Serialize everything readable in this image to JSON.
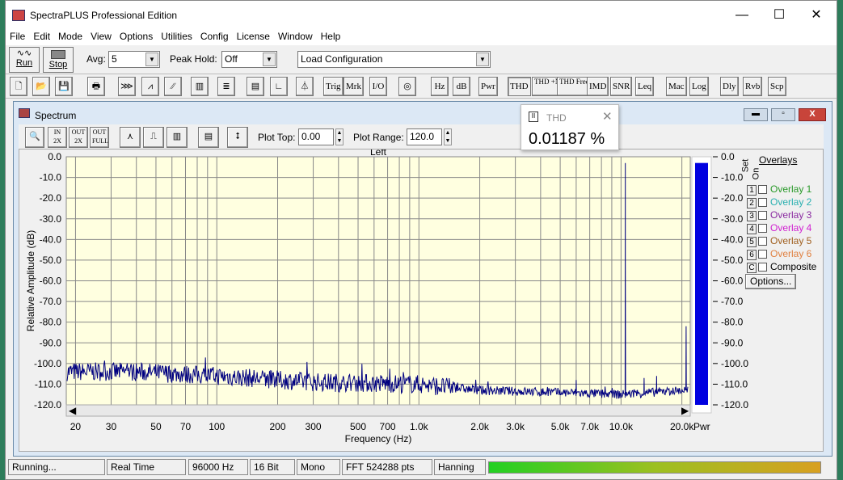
{
  "window": {
    "title": "SpectraPLUS Professional Edition",
    "minimize": "—",
    "maximize": "☐",
    "close": "✕"
  },
  "menu": [
    "File",
    "Edit",
    "Mode",
    "View",
    "Options",
    "Utilities",
    "Config",
    "License",
    "Window",
    "Help"
  ],
  "toolbar": {
    "run": "Run",
    "stop": "Stop",
    "avg_label": "Avg:",
    "avg_value": "5",
    "peak_hold_label": "Peak Hold:",
    "peak_hold_value": "Off",
    "config_value": "Load Configuration"
  },
  "toolbar2": [
    "Trig",
    "Mrk",
    "I/O",
    "Hz",
    "dB",
    "Pwr",
    "THD",
    "THD +N",
    "THD Freq",
    "IMD",
    "SNR",
    "Leq",
    "Mac",
    "Log",
    "Dly",
    "Rvb",
    "Scp"
  ],
  "spectrum": {
    "title": "Spectrum",
    "plot_top_label": "Plot Top:",
    "plot_top_value": "0.00",
    "plot_range_label": "Plot Range:",
    "plot_range_value": "120.0",
    "zoom_buttons": [
      "IN 2X",
      "OUT 2X",
      "OUT FULL"
    ]
  },
  "thd_popup": {
    "title": "THD",
    "value": "0.01187 %"
  },
  "overlays": {
    "header": "Overlays",
    "set_label": "Set",
    "on_label": "On",
    "items": [
      {
        "num": "1",
        "label": "Overlay 1",
        "color": "#2a9a2a"
      },
      {
        "num": "2",
        "label": "Overlay 2",
        "color": "#2ab0b0"
      },
      {
        "num": "3",
        "label": "Overlay 3",
        "color": "#8a2aa0"
      },
      {
        "num": "4",
        "label": "Overlay 4",
        "color": "#d020d0"
      },
      {
        "num": "5",
        "label": "Overlay 5",
        "color": "#a06020"
      },
      {
        "num": "6",
        "label": "Overlay 6",
        "color": "#e08040"
      },
      {
        "num": "C",
        "label": "Composite",
        "color": "#000000"
      }
    ],
    "options": "Options..."
  },
  "chart_data": {
    "type": "line",
    "title": "Left",
    "xlabel": "Frequency (Hz)",
    "ylabel": "Relative Amplitude (dB)",
    "x_scale": "log",
    "xlim": [
      18,
      22000
    ],
    "ylim": [
      -120,
      0
    ],
    "grid": true,
    "xticks": [
      "20",
      "30",
      "50",
      "70",
      "100",
      "200",
      "300",
      "500",
      "700",
      "1.0k",
      "2.0k",
      "3.0k",
      "5.0k",
      "7.0k",
      "10.0k",
      "20.0k"
    ],
    "xtick_values": [
      20,
      30,
      50,
      70,
      100,
      200,
      300,
      500,
      700,
      1000,
      2000,
      3000,
      5000,
      7000,
      10000,
      20000
    ],
    "yticks": [
      "0.0",
      "-10.0",
      "-20.0",
      "-30.0",
      "-40.0",
      "-50.0",
      "-60.0",
      "-70.0",
      "-80.0",
      "-90.0",
      "-100.0",
      "-110.0",
      "-120.0"
    ],
    "noise_floor": [
      [
        20,
        -104
      ],
      [
        40,
        -104
      ],
      [
        100,
        -106
      ],
      [
        300,
        -109
      ],
      [
        1000,
        -110
      ],
      [
        2000,
        -113
      ],
      [
        5000,
        -114
      ],
      [
        10000,
        -115
      ],
      [
        20000,
        -113
      ]
    ],
    "peaks": [
      [
        10500,
        -3
      ],
      [
        10500,
        -50
      ],
      [
        21000,
        -82
      ],
      [
        6000,
        -108
      ],
      [
        13000,
        -107
      ],
      [
        15000,
        -106
      ]
    ],
    "line_color": "#000080",
    "background": "#ffffe0",
    "power_bar": {
      "label": "Pwr",
      "value_db": -3,
      "color": "#0000e0"
    }
  },
  "status": [
    "Running...",
    "Real Time",
    "96000 Hz",
    "16 Bit",
    "Mono",
    "FFT 524288 pts",
    "Hanning"
  ],
  "level_meter": {
    "fraction": 1.0
  }
}
